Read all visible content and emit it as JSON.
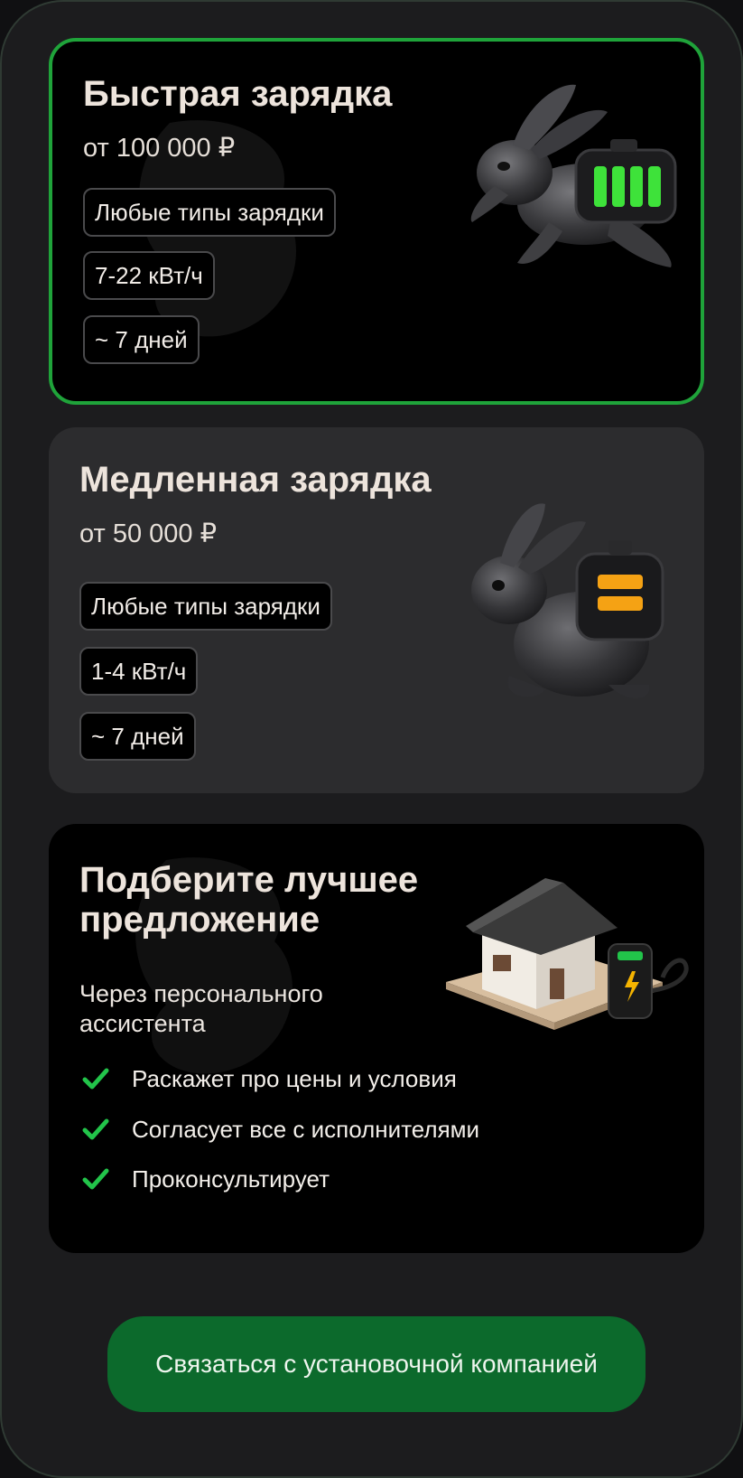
{
  "offers": [
    {
      "title": "Быстрая зарядка",
      "price": "от 100 000 ₽",
      "chips": [
        "Любые типы зарядки",
        "7-22 кВт/ч",
        "~ 7 дней"
      ],
      "battery_color": "#3ee23a"
    },
    {
      "title": "Медленная зарядка",
      "price": "от 50 000 ₽",
      "chips": [
        "Любые типы зарядки",
        "1-4 кВт/ч",
        "~ 7 дней"
      ],
      "battery_color": "#f5a214"
    }
  ],
  "assistant": {
    "title_line1": "Подберите лучшее",
    "title_line2": "предложение",
    "subtitle": "Через персонального ассистента",
    "benefits": [
      "Раскажет про цены и условия",
      "Согласует все с исполнителями",
      "Проконсультирует"
    ]
  },
  "cta_label": "Связаться с установочной компанией",
  "colors": {
    "accent_green": "#1fa33a",
    "button_green": "#0c6a2c",
    "check_green": "#22c44a"
  },
  "icons": [
    "rabbit-battery-icon",
    "rabbit-backpack-icon",
    "house-charger-icon",
    "check-icon"
  ]
}
